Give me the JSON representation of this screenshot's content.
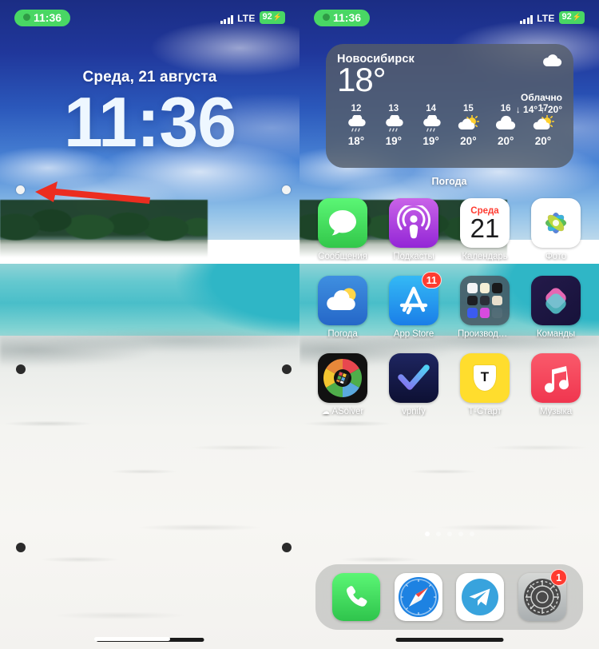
{
  "status_bar": {
    "time": "11:36",
    "network": "LTE",
    "battery": "92",
    "charging_glyph": "⚡"
  },
  "lock_screen": {
    "date": "Среда, 21 августа",
    "time": "11:36"
  },
  "annotation": {
    "arrow_color": "#ec2d20",
    "arrow_direction": "left",
    "points_to": "left-edge-widget-handle"
  },
  "home_screen": {
    "widget": {
      "label": "Погода",
      "city": "Новосибирск",
      "temperature": "18°",
      "condition": "Облачно",
      "low": "↓ 14°",
      "high": "↑ 20°",
      "range": "↓ 14° ↑ 20°",
      "hours": [
        {
          "label": "12",
          "icon": "rain-cloud-icon",
          "temp": "18°"
        },
        {
          "label": "13",
          "icon": "rain-cloud-icon",
          "temp": "19°"
        },
        {
          "label": "14",
          "icon": "rain-cloud-icon",
          "temp": "19°"
        },
        {
          "label": "15",
          "icon": "sun-cloud-icon",
          "temp": "20°"
        },
        {
          "label": "16",
          "icon": "cloud-icon",
          "temp": "20°"
        },
        {
          "label": "17",
          "icon": "sun-cloud-icon",
          "temp": "20°"
        }
      ]
    },
    "apps": [
      [
        {
          "label": "Сообщения",
          "icon": "messages-icon",
          "badge": ""
        },
        {
          "label": "Подкасты",
          "icon": "podcasts-icon",
          "badge": ""
        },
        {
          "label": "Календарь",
          "icon": "calendar-icon",
          "badge": "",
          "cal_weekday": "Среда",
          "cal_day": "21"
        },
        {
          "label": "Фото",
          "icon": "photos-icon",
          "badge": ""
        }
      ],
      [
        {
          "label": "Погода",
          "icon": "weather-icon",
          "badge": ""
        },
        {
          "label": "App Store",
          "icon": "appstore-icon",
          "badge": "11"
        },
        {
          "label": "Производител...",
          "icon": "folder-icon",
          "badge": ""
        },
        {
          "label": "Команды",
          "icon": "shortcuts-icon",
          "badge": ""
        }
      ],
      [
        {
          "label": "ASolver",
          "icon": "asolver-icon",
          "badge": "",
          "prefix_icon": "cloud-download-icon"
        },
        {
          "label": "vpnify",
          "icon": "vpnify-icon",
          "badge": ""
        },
        {
          "label": "Т-Старт",
          "icon": "tstart-icon",
          "badge": ""
        },
        {
          "label": "Музыка",
          "icon": "music-icon",
          "badge": ""
        }
      ]
    ],
    "page_dots": {
      "count": 5,
      "active_index": 0
    },
    "dock": [
      {
        "label": "Телефон",
        "icon": "phone-icon",
        "badge": ""
      },
      {
        "label": "Safari",
        "icon": "safari-icon",
        "badge": ""
      },
      {
        "label": "Telegram",
        "icon": "telegram-icon",
        "badge": ""
      },
      {
        "label": "Настройки",
        "icon": "settings-icon",
        "badge": "1"
      }
    ]
  },
  "colors": {
    "badge_red": "#ff3b30",
    "status_green": "#49d764",
    "arrow_red": "#ec2d20"
  }
}
